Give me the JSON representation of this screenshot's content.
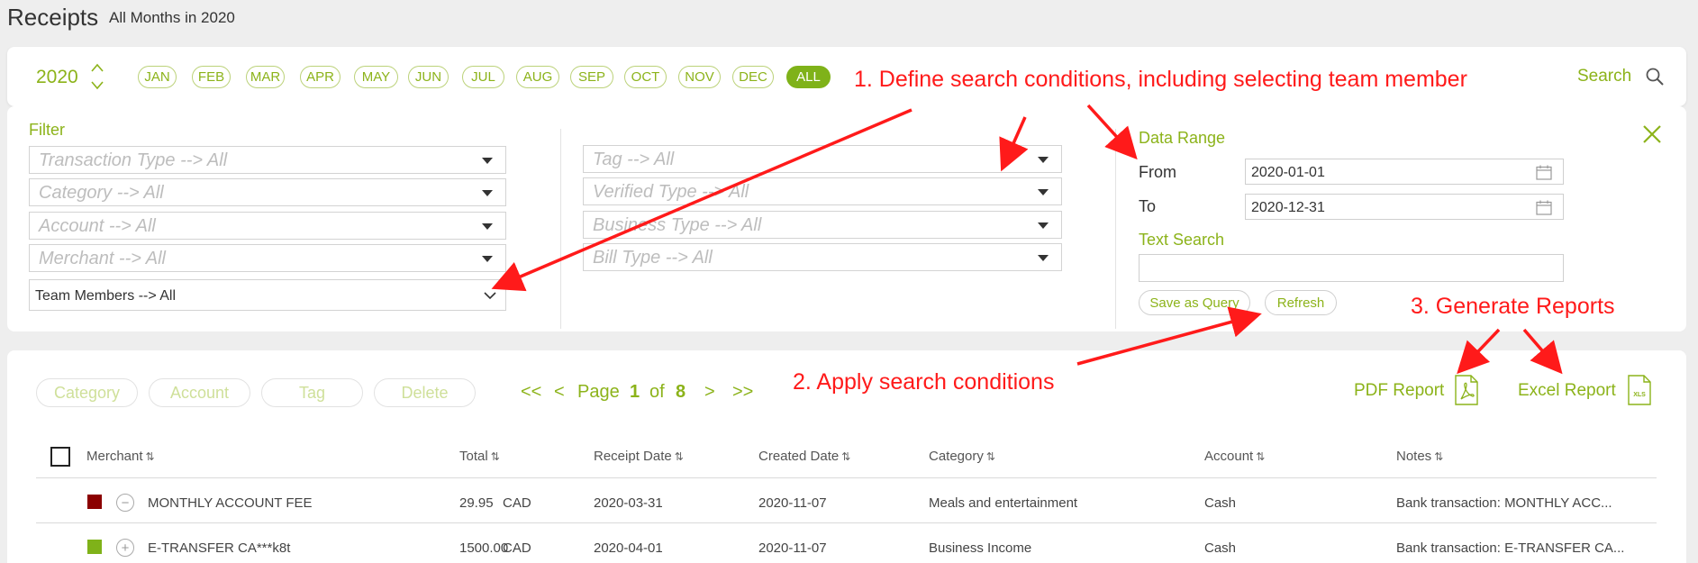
{
  "header": {
    "title": "Receipts",
    "subtitle": "All Months in 2020"
  },
  "month_bar": {
    "year": "2020",
    "months": [
      "JAN",
      "FEB",
      "MAR",
      "APR",
      "MAY",
      "JUN",
      "JUL",
      "AUG",
      "SEP",
      "OCT",
      "NOV",
      "DEC",
      "ALL"
    ],
    "active": "ALL",
    "search_label": "Search"
  },
  "filter": {
    "label": "Filter",
    "left_selects": [
      "Transaction Type --> All",
      "Category --> All",
      "Account --> All",
      "Merchant --> All"
    ],
    "team_members": "Team Members --> All",
    "right_selects": [
      "Tag --> All",
      "Verified Type --> All",
      "Business Type --> All",
      "Bill Type --> All"
    ],
    "date_range_label": "Data Range",
    "from_label": "From",
    "from_value": "2020-01-01",
    "to_label": "To",
    "to_value": "2020-12-31",
    "text_search_label": "Text Search",
    "text_search_value": "",
    "save_query_label": "Save as Query",
    "refresh_label": "Refresh"
  },
  "actions": {
    "category": "Category",
    "account": "Account",
    "tag": "Tag",
    "delete": "Delete"
  },
  "pagination": {
    "first": "<<",
    "prev": "<",
    "page_label": "Page",
    "current": "1",
    "of_label": "of",
    "total": "8",
    "next": ">",
    "last": ">>"
  },
  "reports": {
    "pdf": "PDF Report",
    "excel": "Excel Report",
    "excel_icon_text": "XLS"
  },
  "table": {
    "columns": [
      "Merchant",
      "Total",
      "Receipt Date",
      "Created Date",
      "Category",
      "Account",
      "Notes"
    ],
    "sort_glyph": "⇅",
    "rows": [
      {
        "color": "#8b0000",
        "toggle": "−",
        "merchant": "MONTHLY ACCOUNT FEE",
        "total_amount": "29.95",
        "total_currency": "CAD",
        "receipt_date": "2020-03-31",
        "created_date": "2020-11-07",
        "category": "Meals and entertainment",
        "account": "Cash",
        "notes": "Bank transaction: MONTHLY ACC..."
      },
      {
        "color": "#7fb219",
        "toggle": "+",
        "merchant": "E-TRANSFER CA***k8t",
        "total_amount": "1500.00",
        "total_currency": "CAD",
        "receipt_date": "2020-04-01",
        "created_date": "2020-11-07",
        "category": "Business Income",
        "account": "Cash",
        "notes": "Bank transaction: E-TRANSFER CA..."
      }
    ]
  },
  "annotations": {
    "step1": "1. Define search conditions, including selecting team member",
    "step2": "2. Apply search conditions",
    "step3": "3. Generate Reports"
  },
  "colors": {
    "accent": "#8cb31a",
    "annotation": "#ff1a1a"
  }
}
